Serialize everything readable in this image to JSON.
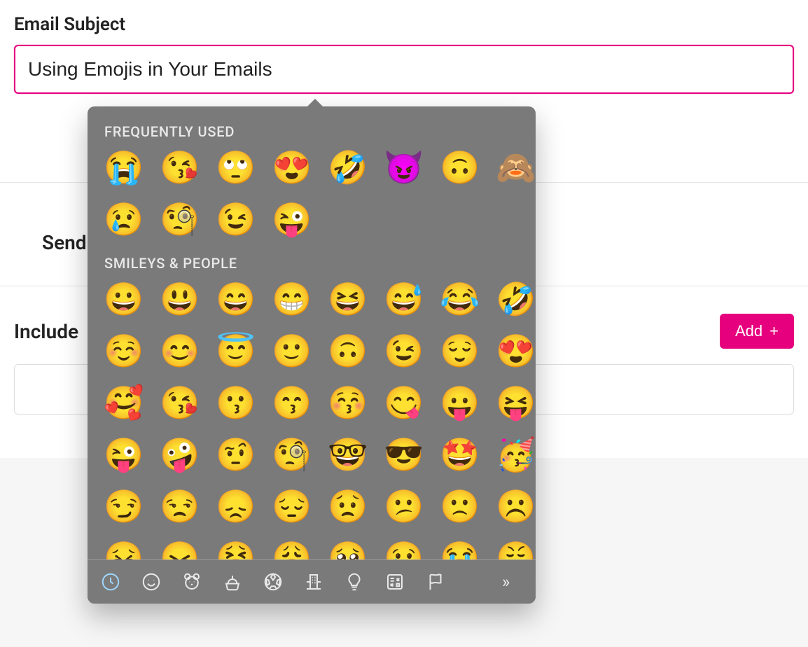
{
  "subject": {
    "label": "Email Subject",
    "value": "Using Emojis in Your Emails "
  },
  "send_label": "Send",
  "include_label": "Include",
  "add_button": {
    "label": "Add",
    "icon": "+"
  },
  "emoji_picker": {
    "sections": {
      "frequently_used": {
        "title": "FREQUENTLY USED",
        "emojis": [
          "😭",
          "😘",
          "🙄",
          "😍",
          "🤣",
          "😈",
          "🙃",
          "🙈",
          "😢",
          "🧐",
          "😉",
          "😜"
        ]
      },
      "smileys_people": {
        "title": "SMILEYS & PEOPLE",
        "emojis": [
          "😀",
          "😃",
          "😄",
          "😁",
          "😆",
          "😅",
          "😂",
          "🤣",
          "☺️",
          "😊",
          "😇",
          "🙂",
          "🙃",
          "😉",
          "😌",
          "😍",
          "🥰",
          "😘",
          "😗",
          "😙",
          "😚",
          "😋",
          "😛",
          "😝",
          "😜",
          "🤪",
          "🤨",
          "🧐",
          "🤓",
          "😎",
          "🤩",
          "🥳",
          "😏",
          "😒",
          "😞",
          "😔",
          "😟",
          "😕",
          "🙁",
          "☹️",
          "😣",
          "😖",
          "😫",
          "😩",
          "🥺",
          "😢",
          "😭",
          "😤"
        ]
      }
    },
    "categories": [
      {
        "name": "recent",
        "icon": "clock"
      },
      {
        "name": "smileys",
        "icon": "smiley"
      },
      {
        "name": "animals",
        "icon": "bear"
      },
      {
        "name": "food",
        "icon": "food"
      },
      {
        "name": "activity",
        "icon": "soccer"
      },
      {
        "name": "travel",
        "icon": "building"
      },
      {
        "name": "objects",
        "icon": "bulb"
      },
      {
        "name": "symbols",
        "icon": "symbols"
      },
      {
        "name": "flags",
        "icon": "flag"
      }
    ]
  }
}
